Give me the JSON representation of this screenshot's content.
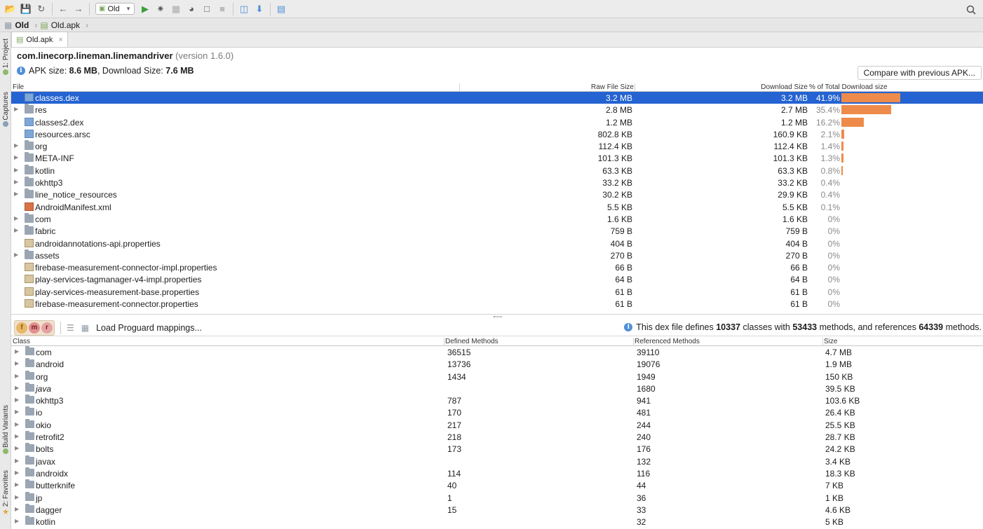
{
  "toolbar": {
    "run_config": "Old",
    "icons": [
      "open-icon",
      "save-icon",
      "sync-icon",
      "back-icon",
      "forward-icon",
      "run-icon",
      "debug-icon",
      "profile-icon",
      "attach-icon",
      "apply-changes-icon",
      "stop-icon",
      "avd-manager-icon",
      "sdk-manager-icon",
      "project-structure-icon"
    ]
  },
  "breadcrumb": {
    "project": "Old",
    "file": "Old.apk"
  },
  "side_tabs": {
    "project": "1: Project",
    "captures": "Captures",
    "build_variants": "Build Variants",
    "favorites": "2: Favorites"
  },
  "editor": {
    "tab_label": "Old.apk"
  },
  "apk": {
    "package": "com.linecorp.lineman.linemandriver",
    "version": "(version 1.6.0)",
    "size_label": "APK size:",
    "size": "8.6 MB",
    "download_label": ", Download Size:",
    "download": "7.6 MB",
    "compare_button": "Compare with previous APK..."
  },
  "file_table": {
    "headers": {
      "file": "File",
      "raw": "Raw File Size",
      "download": "Download Size",
      "percent": "% of Total Download size"
    },
    "rows": [
      {
        "name": "classes.dex",
        "type": "dex",
        "expandable": false,
        "raw": "3.2 MB",
        "dl": "3.2 MB",
        "pct": "41.9%",
        "share": 41.9,
        "selected": true
      },
      {
        "name": "res",
        "type": "folder",
        "expandable": true,
        "raw": "2.8 MB",
        "dl": "2.7 MB",
        "pct": "35.4%",
        "share": 35.4
      },
      {
        "name": "classes2.dex",
        "type": "dex",
        "expandable": false,
        "raw": "1.2 MB",
        "dl": "1.2 MB",
        "pct": "16.2%",
        "share": 16.2
      },
      {
        "name": "resources.arsc",
        "type": "dex",
        "expandable": false,
        "raw": "802.8 KB",
        "dl": "160.9 KB",
        "pct": "2.1%",
        "share": 2.1
      },
      {
        "name": "org",
        "type": "folder",
        "expandable": true,
        "raw": "112.4 KB",
        "dl": "112.4 KB",
        "pct": "1.4%",
        "share": 1.4
      },
      {
        "name": "META-INF",
        "type": "folder",
        "expandable": true,
        "raw": "101.3 KB",
        "dl": "101.3 KB",
        "pct": "1.3%",
        "share": 1.3
      },
      {
        "name": "kotlin",
        "type": "folder",
        "expandable": true,
        "raw": "63.3 KB",
        "dl": "63.3 KB",
        "pct": "0.8%",
        "share": 0.8
      },
      {
        "name": "okhttp3",
        "type": "folder",
        "expandable": true,
        "raw": "33.2 KB",
        "dl": "33.2 KB",
        "pct": "0.4%",
        "share": 0
      },
      {
        "name": "line_notice_resources",
        "type": "folder",
        "expandable": true,
        "raw": "30.2 KB",
        "dl": "29.9 KB",
        "pct": "0.4%",
        "share": 0
      },
      {
        "name": "AndroidManifest.xml",
        "type": "xml",
        "expandable": false,
        "raw": "5.5 KB",
        "dl": "5.5 KB",
        "pct": "0.1%",
        "share": 0
      },
      {
        "name": "com",
        "type": "folder",
        "expandable": true,
        "raw": "1.6 KB",
        "dl": "1.6 KB",
        "pct": "0%",
        "share": 0
      },
      {
        "name": "fabric",
        "type": "folder",
        "expandable": true,
        "raw": "759 B",
        "dl": "759 B",
        "pct": "0%",
        "share": 0
      },
      {
        "name": "androidannotations-api.properties",
        "type": "prop",
        "expandable": false,
        "raw": "404 B",
        "dl": "404 B",
        "pct": "0%",
        "share": 0
      },
      {
        "name": "assets",
        "type": "folder",
        "expandable": true,
        "raw": "270 B",
        "dl": "270 B",
        "pct": "0%",
        "share": 0
      },
      {
        "name": "firebase-measurement-connector-impl.properties",
        "type": "prop",
        "expandable": false,
        "raw": "66 B",
        "dl": "66 B",
        "pct": "0%",
        "share": 0
      },
      {
        "name": "play-services-tagmanager-v4-impl.properties",
        "type": "prop",
        "expandable": false,
        "raw": "64 B",
        "dl": "64 B",
        "pct": "0%",
        "share": 0
      },
      {
        "name": "play-services-measurement-base.properties",
        "type": "prop",
        "expandable": false,
        "raw": "61 B",
        "dl": "61 B",
        "pct": "0%",
        "share": 0
      },
      {
        "name": "firebase-measurement-connector.properties",
        "type": "prop",
        "expandable": false,
        "raw": "61 B",
        "dl": "61 B",
        "pct": "0%",
        "share": 0
      }
    ]
  },
  "dex_panel": {
    "proguard_label": "Load Proguard mappings...",
    "info_prefix": "This dex file defines ",
    "classes": "10337",
    "info_mid1": " classes with ",
    "methods": "53433",
    "info_mid2": " methods, and references ",
    "references": "64339",
    "info_suffix": " methods.",
    "filter_buttons": [
      "f",
      "m",
      "r"
    ]
  },
  "class_table": {
    "headers": {
      "class": "Class",
      "defined": "Defined Methods",
      "referenced": "Referenced Methods",
      "size": "Size"
    },
    "rows": [
      {
        "name": "com",
        "defined": "36515",
        "referenced": "39110",
        "size": "4.7 MB"
      },
      {
        "name": "android",
        "defined": "13736",
        "referenced": "19076",
        "size": "1.9 MB"
      },
      {
        "name": "org",
        "defined": "1434",
        "referenced": "1949",
        "size": "150 KB"
      },
      {
        "name": "java",
        "defined": "",
        "referenced": "1680",
        "size": "39.5 KB",
        "italic": true
      },
      {
        "name": "okhttp3",
        "defined": "787",
        "referenced": "941",
        "size": "103.6 KB"
      },
      {
        "name": "io",
        "defined": "170",
        "referenced": "481",
        "size": "26.4 KB"
      },
      {
        "name": "okio",
        "defined": "217",
        "referenced": "244",
        "size": "25.5 KB"
      },
      {
        "name": "retrofit2",
        "defined": "218",
        "referenced": "240",
        "size": "28.7 KB"
      },
      {
        "name": "bolts",
        "defined": "173",
        "referenced": "176",
        "size": "24.2 KB"
      },
      {
        "name": "javax",
        "defined": "",
        "referenced": "132",
        "size": "3.4 KB"
      },
      {
        "name": "androidx",
        "defined": "114",
        "referenced": "116",
        "size": "18.3 KB"
      },
      {
        "name": "butterknife",
        "defined": "40",
        "referenced": "44",
        "size": "7 KB"
      },
      {
        "name": "jp",
        "defined": "1",
        "referenced": "36",
        "size": "1 KB"
      },
      {
        "name": "dagger",
        "defined": "15",
        "referenced": "33",
        "size": "4.6 KB"
      },
      {
        "name": "kotlin",
        "defined": "",
        "referenced": "32",
        "size": "5 KB"
      }
    ]
  },
  "colors": {
    "selection": "#2463d1",
    "bar": "#ee8b4a"
  }
}
